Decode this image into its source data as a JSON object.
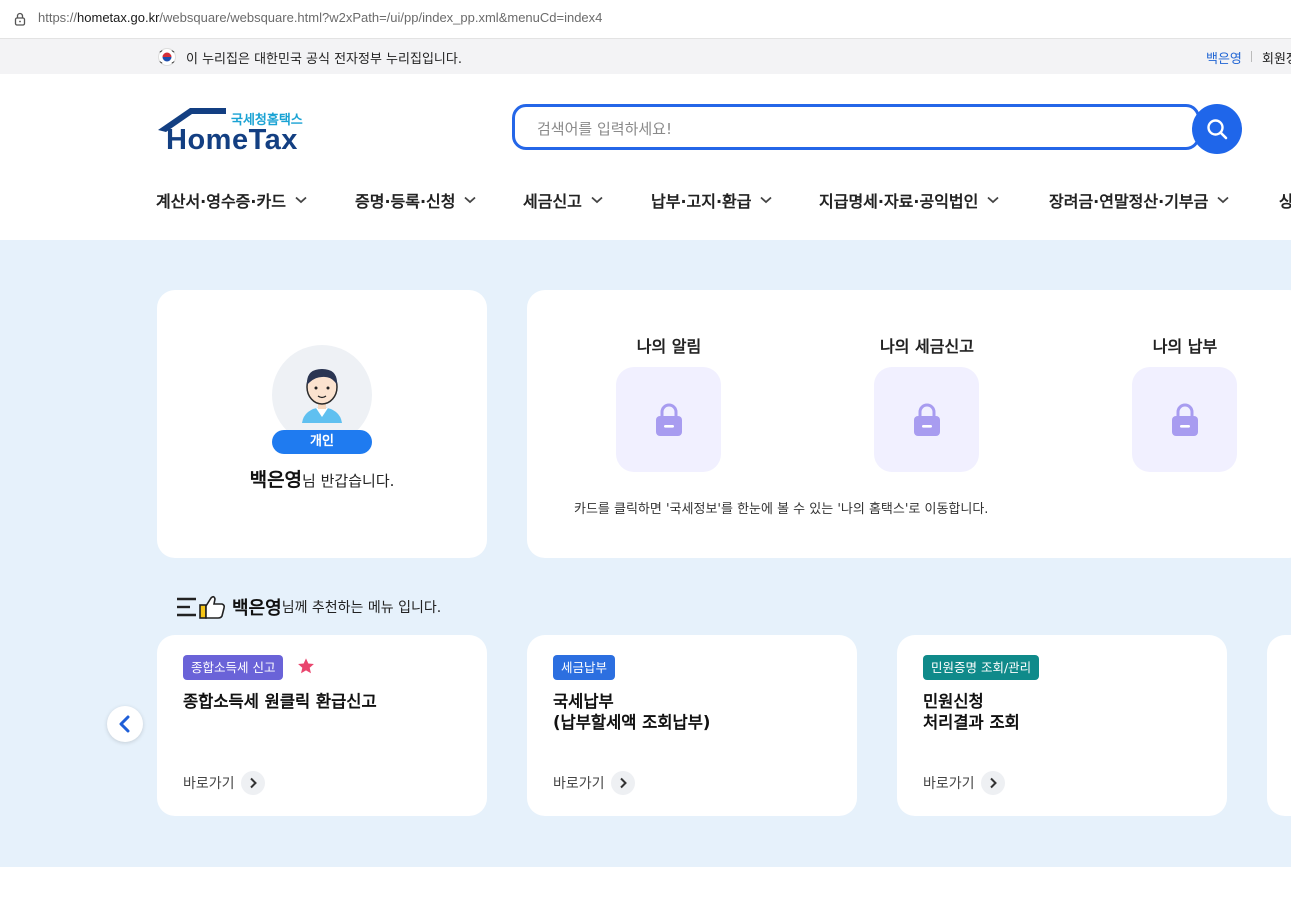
{
  "browser": {
    "url_prefix": "https://",
    "url_domain": "hometax.go.kr",
    "url_path": "/websquare/websquare.html?w2xPath=/ui/pp/index_pp.xml&menuCd=index4"
  },
  "gov_banner": {
    "text": "이 누리집은 대한민국 공식 전자정부 누리집입니다.",
    "user_link": "백은영",
    "member_link": "회원정"
  },
  "header": {
    "logo_small": "국세청홈택스",
    "logo_big": "HomeTax",
    "search_placeholder": "검색어를 입력하세요!"
  },
  "nav": {
    "items": [
      {
        "label": "계산서·영수증·카드"
      },
      {
        "label": "증명·등록·신청"
      },
      {
        "label": "세금신고"
      },
      {
        "label": "납부·고지·환급"
      },
      {
        "label": "지급명세·자료·공익법인"
      },
      {
        "label": "장려금·연말정산·기부금"
      },
      {
        "label": "상"
      }
    ]
  },
  "profile": {
    "badge": "개인",
    "user_name": "백은영",
    "greeting_suffix": "님 반갑습니다."
  },
  "my_section": {
    "items": [
      {
        "title": "나의 알림"
      },
      {
        "title": "나의 세금신고"
      },
      {
        "title": "나의 납부"
      }
    ],
    "note": "카드를 클릭하면 '국세정보'를 한눈에 볼 수 있는 '나의 홈택스'로 이동합니다."
  },
  "recommend": {
    "user_name": "백은영",
    "title_suffix": "님께 추천하는 메뉴 입니다.",
    "cards": [
      {
        "tag": "종합소득세 신고",
        "tag_color": "#6a63d8",
        "title_line1": "종합소득세 원클릭 환급신고",
        "title_line2": "",
        "goto": "바로가기"
      },
      {
        "tag": "세금납부",
        "tag_color": "#2c6fe0",
        "title_line1": "국세납부",
        "title_line2": "(납부할세액 조회납부)",
        "goto": "바로가기"
      },
      {
        "tag": "민원증명 조회/관리",
        "tag_color": "#0f8a8a",
        "title_line1": "민원신청",
        "title_line2": "처리결과 조회",
        "goto": "바로가기"
      }
    ]
  },
  "colors": {
    "accent": "#2466e8",
    "main_bg": "#e6f1fb",
    "favorite_star": "#e9456d"
  }
}
